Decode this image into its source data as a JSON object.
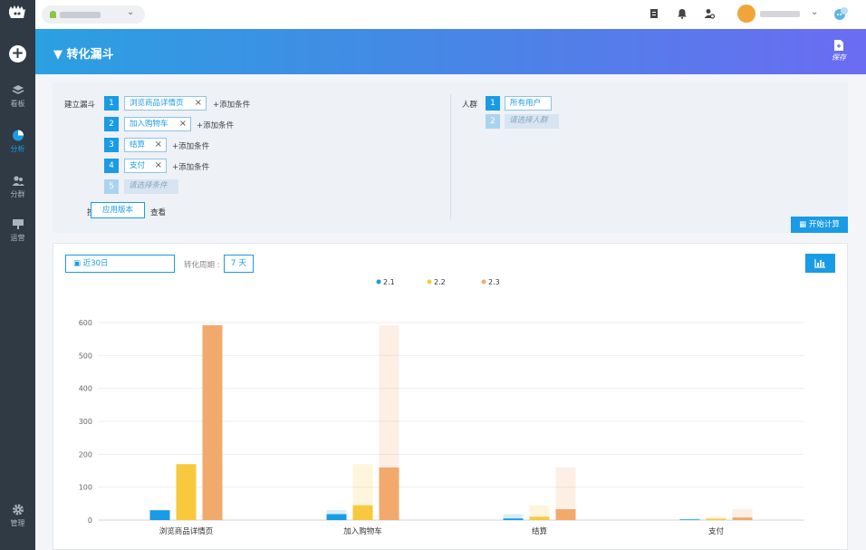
{
  "sidebar": {
    "items": [
      {
        "label": "看板",
        "icon": "layers-icon"
      },
      {
        "label": "分析",
        "icon": "pie-chart-icon",
        "active": true
      },
      {
        "label": "分群",
        "icon": "users-icon"
      },
      {
        "label": "运营",
        "icon": "billboard-icon"
      },
      {
        "label": "管理",
        "icon": "gear-icon"
      }
    ]
  },
  "header": {
    "title": "转化漏斗",
    "save_label": "保存"
  },
  "funnel": {
    "label": "建立漏斗",
    "steps": [
      {
        "num": "1",
        "name": "浏览商品详情页"
      },
      {
        "num": "2",
        "name": "加入购物车"
      },
      {
        "num": "3",
        "name": "结算"
      },
      {
        "num": "4",
        "name": "支付"
      }
    ],
    "next_num": "5",
    "placeholder": "请选择条件",
    "add_condition": "+添加条件",
    "by_label": "按",
    "version_button": "应用版本",
    "view_label": "查看"
  },
  "crowd": {
    "label": "人群",
    "items": [
      {
        "num": "1",
        "name": "所有用户"
      }
    ],
    "next_num": "2",
    "placeholder": "请选择人群"
  },
  "calc_button": "开始计算",
  "filters": {
    "date_range": "近30日",
    "cycle_label": "转化周期 :",
    "cycle_value": "7 天"
  },
  "colors": {
    "accent": "#1a9be6",
    "series_2_1": "#1a9be6",
    "series_2_2": "#f8c93d",
    "series_2_3": "#f2a96c"
  },
  "chart_data": {
    "type": "bar",
    "categories": [
      "浏览商品详情页",
      "加入购物车",
      "结算",
      "支付"
    ],
    "series": [
      {
        "name": "2.1",
        "values": [
          30,
          18,
          5,
          2
        ],
        "ghost": [
          30,
          30,
          18,
          5
        ]
      },
      {
        "name": "2.2",
        "values": [
          170,
          45,
          10,
          4
        ],
        "ghost": [
          170,
          170,
          45,
          10
        ]
      },
      {
        "name": "2.3",
        "values": [
          592,
          160,
          33,
          8
        ],
        "ghost": [
          592,
          592,
          160,
          33
        ]
      }
    ],
    "yticks": [
      0,
      100,
      200,
      300,
      400,
      500,
      600
    ],
    "ylim": [
      0,
      600
    ],
    "legend": "top-center",
    "grid": true
  }
}
